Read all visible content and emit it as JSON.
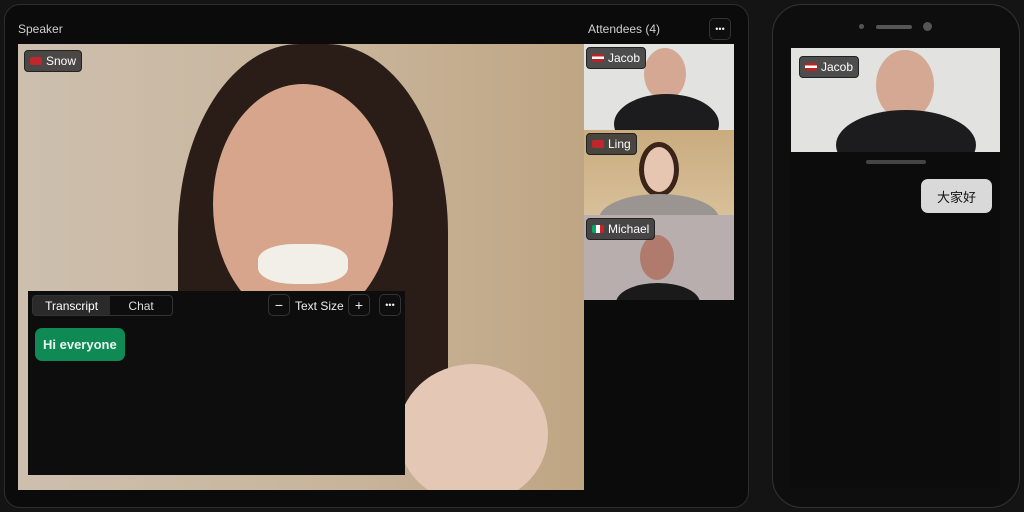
{
  "speaker": {
    "label": "Speaker",
    "name": "Snow",
    "flag": "china-flag"
  },
  "attendees": {
    "label": "Attendees (4)",
    "more": "•••",
    "items": [
      {
        "name": "Jacob",
        "flag": "us-flag"
      },
      {
        "name": "Ling",
        "flag": "china-flag"
      },
      {
        "name": "Michael",
        "flag": "mexico-flag"
      }
    ]
  },
  "transcript": {
    "tabs": [
      "Transcript",
      "Chat"
    ],
    "active_tab": "Transcript",
    "minus": "−",
    "text_size": "Text Size",
    "plus": "+",
    "more": "•••",
    "message": "Hi everyone"
  },
  "phone": {
    "name": "Jacob",
    "flag": "us-flag",
    "message": "大家好"
  },
  "colors": {
    "accent_green": "#0f8a55",
    "bg": "#0b0b0b"
  }
}
